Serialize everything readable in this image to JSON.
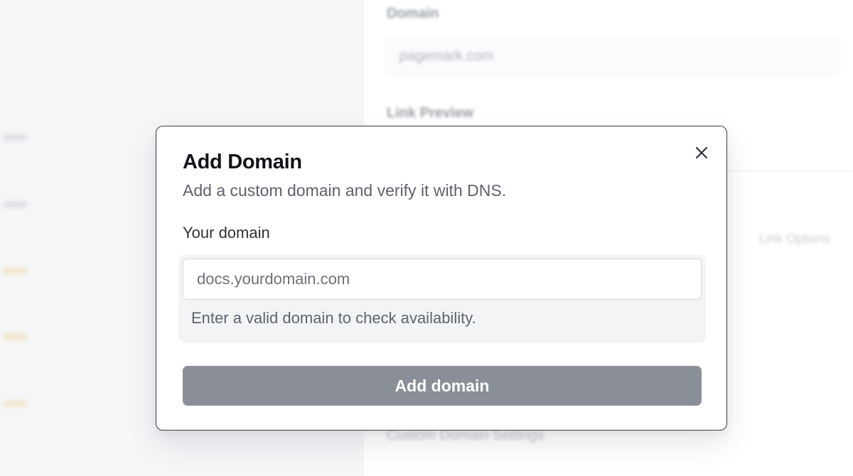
{
  "background": {
    "domain_label": "Domain",
    "domain_value": "pagemark.com",
    "link_preview_label": "Link Preview",
    "side_link": "Link Options",
    "bottom_label": "Custom Domain Settings"
  },
  "modal": {
    "title": "Add Domain",
    "subtitle": "Add a custom domain and verify it with DNS.",
    "close_icon": "close-icon",
    "field": {
      "label": "Your domain",
      "value": "",
      "placeholder": "docs.yourdomain.com",
      "helper": "Enter a valid domain to check availability."
    },
    "submit_label": "Add domain"
  },
  "colors": {
    "submit_disabled": "#8a8f97",
    "modal_border": "#3a3f47",
    "sidebar_bg": "#f5f6f8"
  }
}
